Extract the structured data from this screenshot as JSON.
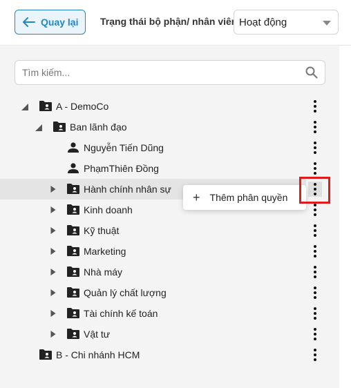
{
  "header": {
    "back_label": "Quay lại",
    "status_label": "Trạng thái bộ phận/ nhân viên",
    "status_value": "Hoạt động"
  },
  "search": {
    "placeholder": "Tìm kiếm..."
  },
  "tree": {
    "nodes": [
      {
        "label": "A - DemoCo",
        "type": "department",
        "expanded": true
      },
      {
        "label": "Ban lãnh đạo",
        "type": "department",
        "expanded": true
      },
      {
        "label": "Nguyễn Tiến Dũng",
        "type": "employee"
      },
      {
        "label": "PhạmThiên Đồng",
        "type": "employee"
      },
      {
        "label": "Hành chính nhân sự",
        "type": "department",
        "expanded": false,
        "highlighted": true
      },
      {
        "label": "Kinh doanh",
        "type": "department",
        "expanded": false
      },
      {
        "label": "Kỹ thuật",
        "type": "department",
        "expanded": false
      },
      {
        "label": "Marketing",
        "type": "department",
        "expanded": false
      },
      {
        "label": "Nhà máy",
        "type": "department",
        "expanded": false
      },
      {
        "label": "Quản lý chất lượng",
        "type": "department",
        "expanded": false
      },
      {
        "label": "Tài chính kế toán",
        "type": "department",
        "expanded": false
      },
      {
        "label": "Vật tư",
        "type": "department",
        "expanded": false
      },
      {
        "label": "B - Chi nhánh HCM",
        "type": "department"
      }
    ]
  },
  "context_menu": {
    "add_permission_label": "Thêm phân quyền"
  },
  "colors": {
    "accent": "#1f86c8",
    "highlight_box": "#e11b1b",
    "panel_bg": "#f5f4f5"
  }
}
